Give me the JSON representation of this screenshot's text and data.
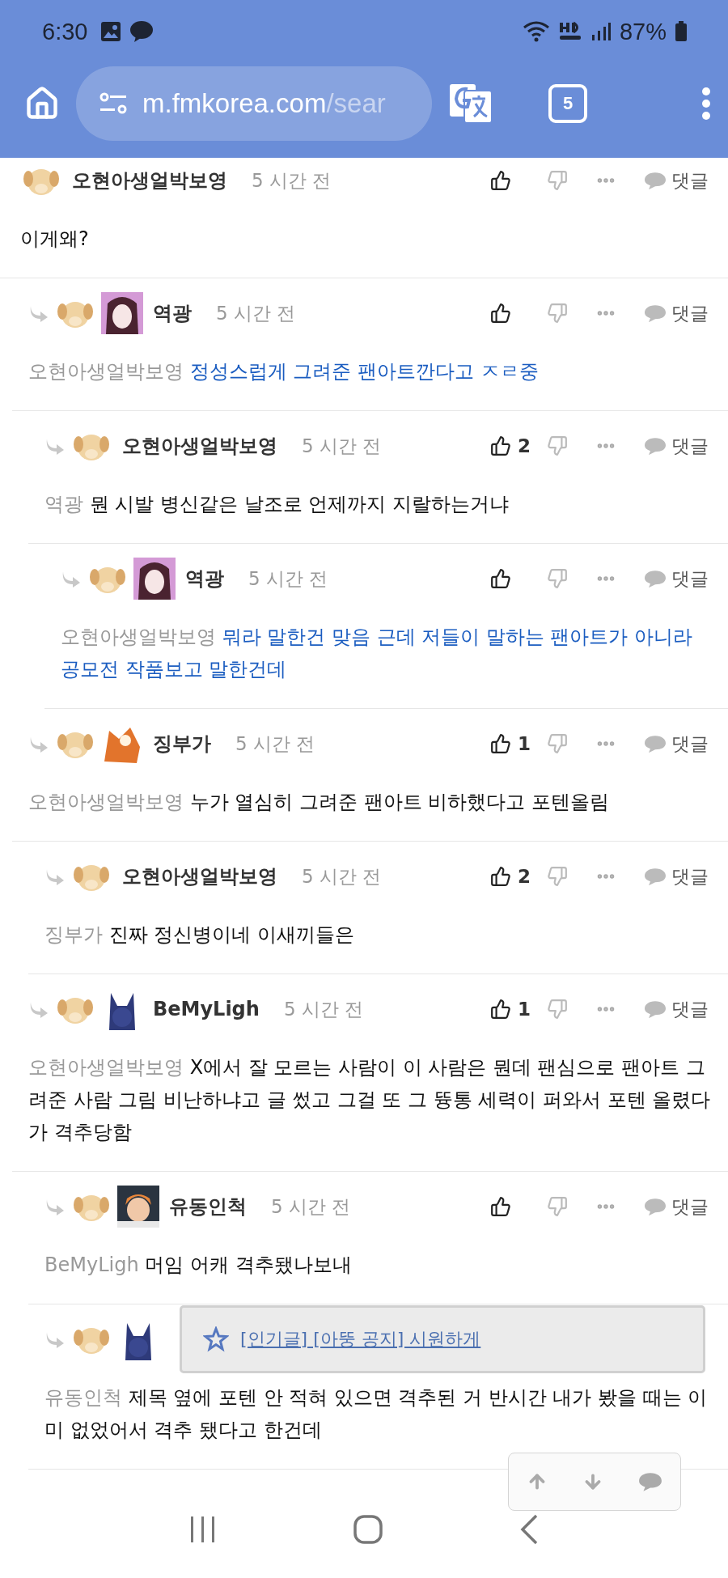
{
  "status_bar": {
    "time": "6:30",
    "battery": "87%"
  },
  "browser": {
    "url_host": "m.fmkorea.com",
    "url_path": "/sear",
    "tab_count": "5"
  },
  "comments": [
    {
      "author": "오현아생얼박보영",
      "time": "5 시간 전",
      "avatars": [
        {
          "kind": "picture"
        }
      ],
      "text": "이게왜?",
      "highlighted": false,
      "reply_label": "댓글",
      "children": [
        {
          "author": "역광",
          "time": "5 시간 전",
          "avatars": [
            {
              "kind": "picture"
            },
            {
              "kind": "picture"
            }
          ],
          "reply_to": "오현아생얼박보영",
          "text": "정성스럽게 그려준 팬아트깐다고 ㅈㄹ중",
          "highlighted": true,
          "reply_label": "댓글",
          "children": [
            {
              "author": "오현아생얼박보영",
              "time": "5 시간 전",
              "likes": "2",
              "avatars": [
                {
                  "kind": "picture"
                }
              ],
              "reply_to": "역광",
              "text": "뭔 시발 병신같은 날조로 언제까지 지랄하는거냐",
              "highlighted": false,
              "reply_label": "댓글",
              "children": [
                {
                  "author": "역광",
                  "time": "5 시간 전",
                  "avatars": [
                    {
                      "kind": "picture"
                    },
                    {
                      "kind": "picture"
                    }
                  ],
                  "reply_to": "오현아생얼박보영",
                  "text": "뭐라 말한건 맞음 근데 저들이 말하는 팬아트가 아니라 공모전 작품보고 말한건데",
                  "highlighted": true,
                  "reply_label": "댓글"
                }
              ]
            }
          ]
        },
        {
          "author": "징부가",
          "time": "5 시간 전",
          "likes": "1",
          "avatars": [
            {
              "kind": "picture"
            },
            {
              "kind": "picture"
            }
          ],
          "reply_to": "오현아생얼박보영",
          "text": "누가 열심히 그려준 팬아트 비하했다고 포텐올림",
          "highlighted": false,
          "reply_label": "댓글",
          "children": [
            {
              "author": "오현아생얼박보영",
              "time": "5 시간 전",
              "likes": "2",
              "avatars": [
                {
                  "kind": "picture"
                }
              ],
              "reply_to": "징부가",
              "text": "진짜 정신병이네 이새끼들은",
              "highlighted": false,
              "reply_label": "댓글"
            }
          ]
        },
        {
          "author": "BeMyLigh",
          "time": "5 시간 전",
          "likes": "1",
          "avatars": [
            {
              "kind": "picture"
            },
            {
              "kind": "picture"
            }
          ],
          "reply_to": "오현아생얼박보영",
          "text": "X에서 잘 모르는 사람이 이 사람은 뭔데 팬심으로 팬아트 그려준 사람 그림 비난하냐고 글 썼고 그걸 또 그 뜡통 세력이 퍼와서 포텐 올렸다가 격추당함",
          "highlighted": false,
          "reply_label": "댓글",
          "children": [
            {
              "author": "유동인척",
              "time": "5 시간 전",
              "avatars": [
                {
                  "kind": "picture"
                },
                {
                  "kind": "picture"
                }
              ],
              "reply_to": "BeMyLigh",
              "text": "머임 어캐 격추됐나보내",
              "highlighted": false,
              "reply_label": "댓글"
            },
            {
              "avatars": [
                {
                  "kind": "picture"
                },
                {
                  "kind": "picture"
                }
              ],
              "reply_to": "유동인척",
              "text": "제목 옆에 포텐 안 적혀 있으면 격추된 거 반시간 내가 봤을 때는 이미 없었어서 격추 됐다고 한건데",
              "highlighted": false
            }
          ]
        }
      ]
    }
  ],
  "notice": {
    "text": "[인기글] [아뚱 공지] 시원하게"
  }
}
